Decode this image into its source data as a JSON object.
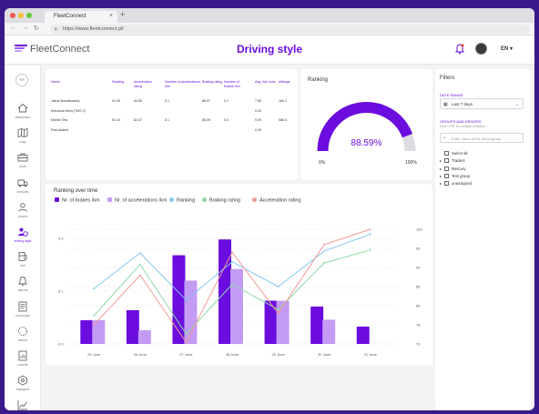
{
  "browser": {
    "tab_title": "FleetConnect",
    "tab_close": "×",
    "new_tab": "+",
    "back": "←",
    "forward": "→",
    "reload": "↻",
    "url": "https://www.fleetconnect.pl/"
  },
  "header": {
    "brand": "FleetConnect",
    "title": "Driving style",
    "language": "EN ▾"
  },
  "sidebar": {
    "toggle": "«»",
    "items": [
      {
        "label": "dashboard",
        "icon": "house-icon"
      },
      {
        "label": "map",
        "icon": "map-icon"
      },
      {
        "label": "work",
        "icon": "briefcase-icon"
      },
      {
        "label": "vehicles",
        "icon": "truck-icon"
      },
      {
        "label": "drivers",
        "icon": "user-icon"
      },
      {
        "label": "driving style",
        "icon": "steering-icon"
      },
      {
        "label": "fuel",
        "icon": "fuel-icon"
      },
      {
        "label": "alarms",
        "icon": "bell-icon"
      },
      {
        "label": "refuelings",
        "icon": "document-icon"
      },
      {
        "label": "detour",
        "icon": "detour-icon"
      },
      {
        "label": "reports",
        "icon": "report-icon"
      },
      {
        "label": "transport",
        "icon": "hexagon-icon"
      },
      {
        "label": "",
        "icon": "chart-icon"
      }
    ]
  },
  "drivers_table": {
    "columns": [
      "Name",
      "Ranking",
      "Acceleration rating",
      "Number of accelerations /km",
      "Braking rating",
      "Number of brakes /km",
      "Avg. fuel cons.",
      "Mileage"
    ],
    "rows": [
      [
        "Jakub Nowakowsky",
        "91.05",
        "84.50",
        "0.1",
        "88.57",
        "0.1",
        "7.80",
        "184.2"
      ],
      [
        "Kierowca Mera (TMS 2)",
        "",
        "",
        "",
        "",
        "",
        "0.00",
        ""
      ],
      [
        "Mobile Test",
        "92.10",
        "82.07",
        "0.1",
        "85.09",
        "0.3",
        "9.09",
        "566.5"
      ],
      [
        "Paul Adams",
        "",
        "",
        "",
        "",
        "",
        "0.00",
        ""
      ]
    ]
  },
  "ranking": {
    "title": "Ranking",
    "value_label": "88.59%",
    "value": 88.59,
    "min_label": "0%",
    "max_label": "100%"
  },
  "filters": {
    "title": "Filters",
    "date_range_label": "DATE RANGE",
    "date_range_value": "Last 7 days",
    "groups_label": "GROUPS AND DRIVERS",
    "groups_hint": "Hold CTRL for multiple selection",
    "search_placeholder": "Enter name of the driver/group",
    "tree": [
      {
        "label": "Select all",
        "expandable": false
      },
      {
        "label": "Traders",
        "expandable": true
      },
      {
        "label": "Mercury",
        "expandable": true
      },
      {
        "label": "Test group",
        "expandable": true
      },
      {
        "label": "unassigned",
        "expandable": true
      }
    ]
  },
  "chart_data": {
    "type": "bar",
    "title": "Ranking over time",
    "categories": [
      "25 June",
      "26 June",
      "27 June",
      "28 June",
      "29 June",
      "30 June",
      "31 June"
    ],
    "left_axis": {
      "ticks": [
        "0.0",
        "0.1",
        "0.2"
      ],
      "ylim": [
        0,
        0.2
      ]
    },
    "right_axis": {
      "ticks": [
        "70",
        "75",
        "80",
        "85",
        "90",
        "95",
        "100"
      ],
      "ylim": [
        70,
        100
      ]
    },
    "series": [
      {
        "name": "Nr. of brakes /km",
        "kind": "bar",
        "axis": "left",
        "color": "#6a0dde",
        "values": [
          0.045,
          0.064,
          0.168,
          0.198,
          0.082,
          0.071,
          0.033
        ]
      },
      {
        "name": "Nr. of accelerations /km",
        "kind": "bar",
        "axis": "left",
        "color": "#c39bf5",
        "values": [
          0.045,
          0.026,
          0.12,
          0.142,
          0.082,
          0.046,
          null
        ]
      },
      {
        "name": "Ranking",
        "kind": "line",
        "axis": "right",
        "color": "#83c8ee",
        "values": [
          84.5,
          93.8,
          81.5,
          91.5,
          85.0,
          94.3,
          98.7
        ]
      },
      {
        "name": "Braking rating",
        "kind": "line",
        "axis": "right",
        "color": "#8ed9a6",
        "values": [
          77.4,
          90.8,
          72.6,
          85.6,
          79.0,
          91.2,
          94.6
        ]
      },
      {
        "name": "Acceleration rating",
        "kind": "line",
        "axis": "right",
        "color": "#f29b96",
        "values": [
          75.0,
          88.0,
          70.4,
          94.0,
          78.0,
          96.0,
          100.0
        ]
      }
    ],
    "grid": true,
    "legend": "top-left"
  }
}
